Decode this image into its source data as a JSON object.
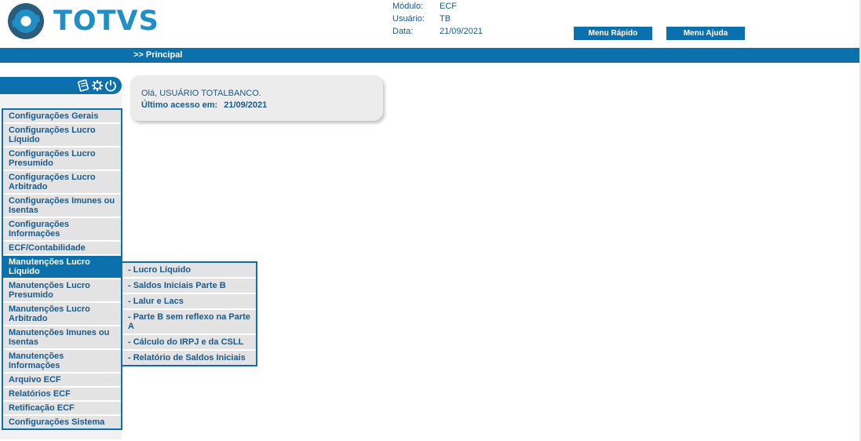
{
  "brand": {
    "logo_text": "TOTVS",
    "color": "#1f8fc6"
  },
  "info": {
    "modulo_label": "Módulo:",
    "modulo_value": "ECF",
    "usuario_label": "Usuário:",
    "usuario_value": "TB",
    "data_label": "Data:",
    "data_value": "21/09/2021"
  },
  "buttons": {
    "menu_rapido": "Menu Rápido",
    "menu_ajuda": "Menu Ajuda"
  },
  "breadcrumb": ">> Principal",
  "sidebar_icons": [
    "notes-icon",
    "gear-icon",
    "power-icon"
  ],
  "sidebar": {
    "items": [
      "Configurações Gerais",
      "Configurações Lucro Líquido",
      "Configurações Lucro Presumido",
      "Configurações Lucro Arbitrado",
      "Configurações Imunes ou Isentas",
      "Configurações Informações",
      "ECF/Contabilidade",
      "Manutenções Lucro Líquido",
      "Manutenções Lucro Presumido",
      "Manutenções Lucro Arbitrado",
      "Manutenções Imunes ou Isentas",
      "Manutenções Informações",
      "Arquivo ECF",
      "Relatórios ECF",
      "Retificação ECF",
      "Configurações Sistema"
    ],
    "active_index": 7
  },
  "submenu": {
    "items": [
      "- Lucro Líquido",
      "- Saldos Iniciais Parte B",
      "- Lalur e Lacs",
      "- Parte B sem reflexo na Parte A",
      "- Cálculo do IRPJ e da CSLL",
      "- Relatório de Saldos Iniciais"
    ]
  },
  "welcome": {
    "greeting": "Olá, USUÁRIO TOTALBANCO.",
    "last_access_label": "Último acesso em:",
    "last_access_value": "21/09/2021"
  },
  "colors": {
    "accent": "#0b70ac",
    "text": "#1a5a8a",
    "item_bg": "#e3e3e3"
  }
}
